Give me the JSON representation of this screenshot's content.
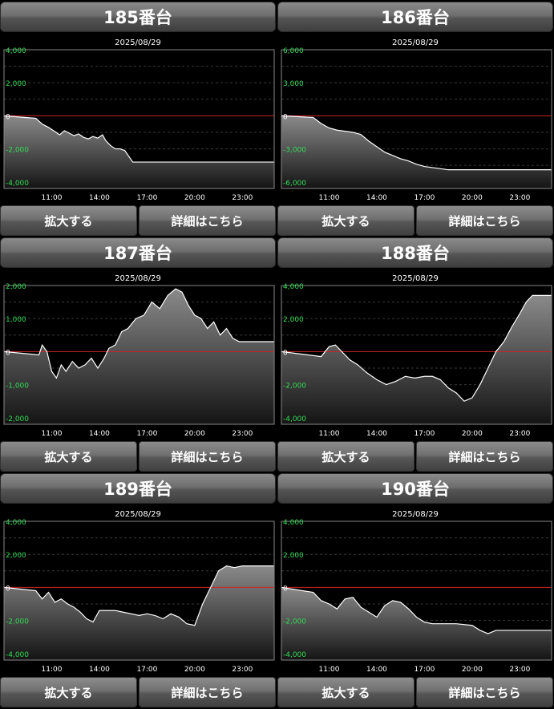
{
  "panels": [
    {
      "title": "185番台",
      "zoom_label": "拡大する",
      "details_label": "詳細はこちら",
      "chart_data": {
        "type": "area",
        "title": "2025/08/29",
        "xlim": [
          8,
          25
        ],
        "x_ticks": [
          11,
          14,
          17,
          20,
          23
        ],
        "x_tick_labels": [
          "11:00",
          "14:00",
          "17:00",
          "20:00",
          "23:00"
        ],
        "ylim": [
          -4400,
          4000
        ],
        "y_ticks": [
          4000,
          2000,
          0,
          -2000,
          -4000
        ],
        "y_tick_labels": [
          "4,000",
          "2,000",
          "0",
          "-2,000",
          "-4,000"
        ],
        "zero_line_color": "#cc2222",
        "x": [
          8,
          10,
          10.4,
          10.8,
          11.2,
          11.5,
          11.8,
          12.1,
          12.4,
          12.7,
          13,
          13.3,
          13.6,
          13.9,
          14.2,
          14.4,
          14.7,
          15,
          15.3,
          15.6,
          16.1,
          17,
          20,
          25
        ],
        "y": [
          0,
          -150,
          -500,
          -700,
          -950,
          -1150,
          -900,
          -1050,
          -1200,
          -1100,
          -1300,
          -1400,
          -1250,
          -1350,
          -1150,
          -1500,
          -1800,
          -2000,
          -2000,
          -2100,
          -2800,
          -2800,
          -2800,
          -2800
        ]
      }
    },
    {
      "title": "186番台",
      "zoom_label": "拡大する",
      "details_label": "詳細はこちら",
      "chart_data": {
        "type": "area",
        "title": "2025/08/29",
        "xlim": [
          8,
          25
        ],
        "x_ticks": [
          11,
          14,
          17,
          20,
          23
        ],
        "x_tick_labels": [
          "11:00",
          "14:00",
          "17:00",
          "20:00",
          "23:00"
        ],
        "ylim": [
          -6600,
          6000
        ],
        "y_ticks": [
          6000,
          3000,
          0,
          -3000,
          -6000
        ],
        "y_tick_labels": [
          "6,000",
          "3,000",
          "0",
          "-3,000",
          "-6,000"
        ],
        "zero_line_color": "#cc2222",
        "x": [
          8,
          10,
          10.5,
          11,
          11.5,
          12,
          12.5,
          13,
          13.5,
          14,
          14.5,
          15,
          15.5,
          16,
          16.5,
          17,
          17.5,
          18,
          18.5,
          19,
          25
        ],
        "y": [
          0,
          -150,
          -700,
          -1100,
          -1300,
          -1400,
          -1500,
          -1700,
          -2300,
          -2800,
          -3300,
          -3600,
          -3900,
          -4100,
          -4400,
          -4600,
          -4700,
          -4800,
          -4900,
          -4900,
          -4900
        ]
      }
    },
    {
      "title": "187番台",
      "zoom_label": "拡大する",
      "details_label": "詳細はこちら",
      "chart_data": {
        "type": "area",
        "title": "2025/08/29",
        "xlim": [
          8,
          25
        ],
        "x_ticks": [
          11,
          14,
          17,
          20,
          23
        ],
        "x_tick_labels": [
          "11:00",
          "14:00",
          "17:00",
          "20:00",
          "23:00"
        ],
        "ylim": [
          -2200,
          2000
        ],
        "y_ticks": [
          2000,
          1000,
          0,
          -1000,
          -2000
        ],
        "y_tick_labels": [
          "2,000",
          "1,000",
          "0",
          "-1,000",
          "-2,000"
        ],
        "zero_line_color": "#cc2222",
        "x": [
          8,
          10.2,
          10.4,
          10.7,
          11,
          11.3,
          11.6,
          11.9,
          12.3,
          12.7,
          13.1,
          13.5,
          13.9,
          14.3,
          14.6,
          15,
          15.4,
          15.8,
          16.3,
          16.8,
          17.3,
          17.8,
          18.3,
          18.8,
          19.2,
          19.6,
          20,
          20.4,
          20.8,
          21.2,
          21.6,
          22,
          22.4,
          22.8,
          25
        ],
        "y": [
          0,
          -100,
          200,
          0,
          -600,
          -800,
          -400,
          -600,
          -300,
          -500,
          -400,
          -200,
          -500,
          -200,
          100,
          200,
          600,
          700,
          1000,
          1100,
          1500,
          1300,
          1700,
          1900,
          1800,
          1400,
          1100,
          1000,
          700,
          900,
          500,
          700,
          400,
          300,
          300
        ]
      }
    },
    {
      "title": "188番台",
      "zoom_label": "拡大する",
      "details_label": "詳細はこちら",
      "chart_data": {
        "type": "area",
        "title": "2025/08/29",
        "xlim": [
          8,
          25
        ],
        "x_ticks": [
          11,
          14,
          17,
          20,
          23
        ],
        "x_tick_labels": [
          "11:00",
          "14:00",
          "17:00",
          "20:00",
          "23:00"
        ],
        "ylim": [
          -4400,
          4000
        ],
        "y_ticks": [
          4000,
          2000,
          0,
          -2000,
          -4000
        ],
        "y_tick_labels": [
          "4,000",
          "2,000",
          "0",
          "-2,000",
          "-4,000"
        ],
        "zero_line_color": "#cc2222",
        "x": [
          8,
          10.5,
          11,
          11.4,
          11.8,
          12.3,
          12.8,
          13.4,
          14,
          14.6,
          15.2,
          15.8,
          16.4,
          17,
          17.5,
          18,
          18.5,
          19,
          19.5,
          20,
          20.5,
          21,
          21.5,
          22,
          22.5,
          23,
          23.4,
          23.8,
          25
        ],
        "y": [
          0,
          -300,
          300,
          400,
          0,
          -500,
          -800,
          -1300,
          -1700,
          -2000,
          -1800,
          -1500,
          -1600,
          -1500,
          -1500,
          -1700,
          -2200,
          -2500,
          -3000,
          -2800,
          -2000,
          -1000,
          0,
          600,
          1500,
          2300,
          3000,
          3400,
          3400
        ]
      }
    },
    {
      "title": "189番台",
      "zoom_label": "拡大する",
      "details_label": "詳細はこちら",
      "chart_data": {
        "type": "area",
        "title": "2025/08/29",
        "xlim": [
          8,
          25
        ],
        "x_ticks": [
          11,
          14,
          17,
          20,
          23
        ],
        "x_tick_labels": [
          "11:00",
          "14:00",
          "17:00",
          "20:00",
          "23:00"
        ],
        "ylim": [
          -4400,
          4000
        ],
        "y_ticks": [
          4000,
          2000,
          0,
          -2000,
          -4000
        ],
        "y_tick_labels": [
          "4,000",
          "2,000",
          "0",
          "-2,000",
          "-4,000"
        ],
        "zero_line_color": "#cc2222",
        "x": [
          8,
          10,
          10.4,
          10.8,
          11.2,
          11.6,
          12,
          12.4,
          12.8,
          13.2,
          13.6,
          14,
          14.5,
          15,
          15.5,
          16,
          16.5,
          17,
          17.5,
          18,
          18.5,
          19,
          19.5,
          20,
          20.5,
          21,
          21.5,
          22,
          22.5,
          23,
          25
        ],
        "y": [
          0,
          -200,
          -700,
          -300,
          -900,
          -700,
          -1000,
          -1200,
          -1500,
          -1900,
          -2100,
          -1400,
          -1400,
          -1400,
          -1500,
          -1600,
          -1700,
          -1600,
          -1700,
          -1900,
          -1600,
          -1800,
          -2200,
          -2300,
          -1000,
          0,
          1000,
          1300,
          1200,
          1300,
          1300
        ]
      }
    },
    {
      "title": "190番台",
      "zoom_label": "拡大する",
      "details_label": "詳細はこちら",
      "chart_data": {
        "type": "area",
        "title": "2025/08/29",
        "xlim": [
          8,
          25
        ],
        "x_ticks": [
          11,
          14,
          17,
          20,
          23
        ],
        "x_tick_labels": [
          "11:00",
          "14:00",
          "17:00",
          "20:00",
          "23:00"
        ],
        "ylim": [
          -4400,
          4000
        ],
        "y_ticks": [
          4000,
          2000,
          0,
          -2000,
          -4000
        ],
        "y_tick_labels": [
          "4,000",
          "2,000",
          "0",
          "-2,000",
          "-4,000"
        ],
        "zero_line_color": "#cc2222",
        "x": [
          8,
          10,
          10.5,
          11,
          11.5,
          12,
          12.5,
          13,
          13.5,
          14,
          14.5,
          15,
          15.5,
          16,
          16.5,
          17,
          17.5,
          18,
          19,
          20,
          20.5,
          21,
          21.5,
          25
        ],
        "y": [
          0,
          -300,
          -800,
          -1000,
          -1300,
          -700,
          -600,
          -1200,
          -1500,
          -1800,
          -1100,
          -800,
          -900,
          -1300,
          -1800,
          -2100,
          -2200,
          -2200,
          -2200,
          -2300,
          -2600,
          -2800,
          -2600,
          -2600
        ]
      }
    }
  ]
}
